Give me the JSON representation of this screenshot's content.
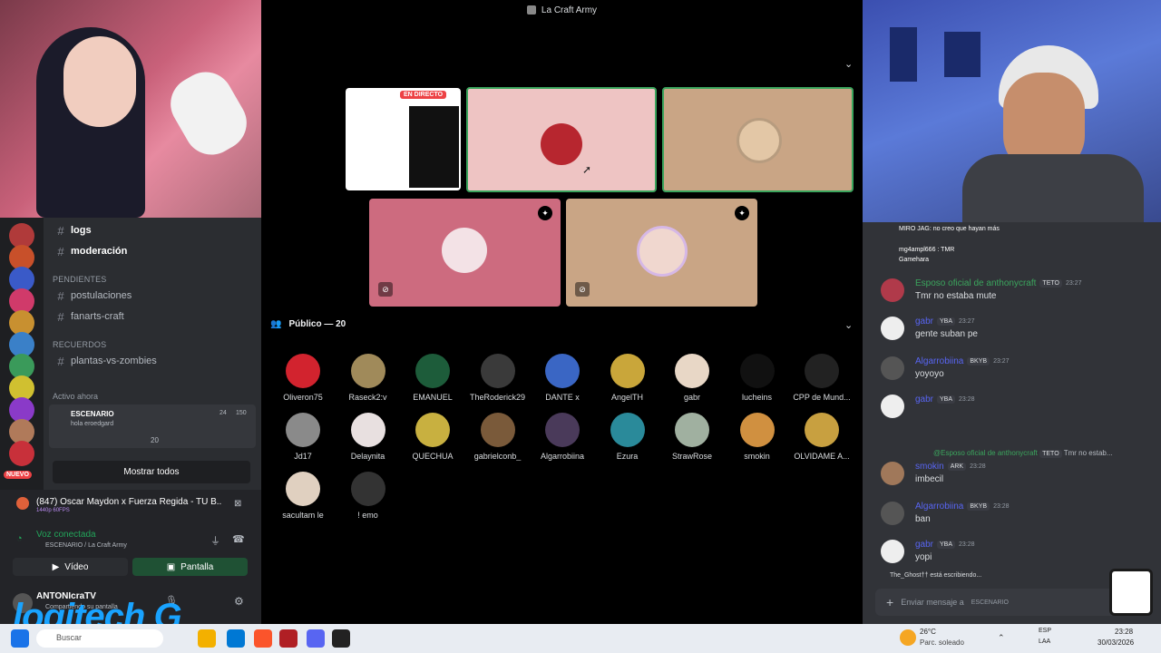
{
  "stage": {
    "title": "La Craft Army",
    "live_badge": "EN DIRECTO",
    "audience_header": "Público — 20",
    "audience": [
      {
        "name": "Oliveron75",
        "color": "#d2232e"
      },
      {
        "name": "Raseck2:v",
        "color": "#a08a5a"
      },
      {
        "name": "EMANUEL",
        "color": "#1d5c3a"
      },
      {
        "name": "TheRoderick29",
        "color": "#3a3a3a"
      },
      {
        "name": "DANTE x",
        "color": "#3a66c4"
      },
      {
        "name": "AngelTH",
        "color": "#c9a63a"
      },
      {
        "name": "gabr",
        "color": "#e8d7c6"
      },
      {
        "name": "lucheins",
        "color": "#111111"
      },
      {
        "name": "CPP de Mund...",
        "color": "#222222"
      },
      {
        "name": "Jd17",
        "color": "#8a8a8a"
      },
      {
        "name": "Delaynita",
        "color": "#e8e0e0"
      },
      {
        "name": "QUECHUA",
        "color": "#c8b040"
      },
      {
        "name": "gabrielconb_",
        "color": "#7a5a3a"
      },
      {
        "name": "Algarrobiina",
        "color": "#4a3a5a"
      },
      {
        "name": "Ezura",
        "color": "#2a8a9a"
      },
      {
        "name": "StrawRose",
        "color": "#a0b0a0"
      },
      {
        "name": "smokin",
        "color": "#d09040"
      },
      {
        "name": "OLVIDAME A...",
        "color": "#c8a040"
      },
      {
        "name": "sacultam le",
        "color": "#e0d0c0"
      },
      {
        "name": "! emo",
        "color": "#333333"
      }
    ]
  },
  "sidebar": {
    "channels_top": [
      "logs",
      "moderación"
    ],
    "pending_category": "Pendientes",
    "pending_channels": [
      "postulaciones",
      "fanarts-craft"
    ],
    "memories_category": "RECUERDOS",
    "memories_channels": [
      "plantas-vs-zombies"
    ],
    "active_now": "Activo ahora",
    "stage_label": "ESCENARIO",
    "stage_topic": "hola eroedgard",
    "stage_cam_count": "24",
    "stage_count": "150",
    "stage_listeners": "20",
    "show_all": "Mostrar todos",
    "new_badge": "NUEVO",
    "server_badges": [
      "76",
      "7",
      "80",
      "31",
      "1",
      "2",
      "2"
    ],
    "media_title": "(847) Oscar Maydon x Fuerza Regida - TU B...",
    "media_sub": "1440p 60FPS",
    "voice_connected": "Voz conectada",
    "voice_channel": "ESCENARIO / La Craft Army",
    "video_button": "Vídeo",
    "screen_button": "Pantalla",
    "user_name": "ANTONIcraTV",
    "user_status": "Compartiendo su pantalla"
  },
  "chat": {
    "messages": [
      {
        "author": "Esposo oficial de anthonycraft",
        "tag": "TETO",
        "time": "23:27",
        "text": "Tmr no estaba mute",
        "color": "#3ba55d"
      },
      {
        "author": "gabr",
        "tag": "YBA",
        "time": "23:27",
        "text": "gente suban pe",
        "color": "#5865f2"
      },
      {
        "author": "Algarrobiina",
        "tag": "BKYB",
        "time": "23:27",
        "text": "yoyoyo",
        "color": "#5865f2"
      },
      {
        "author": "gabr",
        "tag": "YBA",
        "time": "23:28",
        "text": "",
        "color": "#5865f2"
      },
      {
        "author": "smokin",
        "tag": "ARK",
        "time": "23:28",
        "text": "imbecil",
        "color": "#5865f2"
      },
      {
        "author": "Algarrobiina",
        "tag": "BKYB",
        "time": "23:28",
        "text": "ban",
        "color": "#5865f2"
      },
      {
        "author": "gabr",
        "tag": "YBA",
        "time": "23:28",
        "text": "yopi",
        "color": "#5865f2"
      }
    ],
    "reply_ref": "@Esposo oficial de anthonycraft",
    "reply_tag": "TETO",
    "reply_text": "Tmr no estab...",
    "overlay_lines": [
      "MIRO JAG: no creo que hayan más",
      "mg4ampl666 : TMR",
      "Gamehara"
    ],
    "typing": "The_Ghost†† está escribiendo...",
    "input_placeholder": "Enviar mensaje a",
    "input_channel": "ESCENARIO"
  },
  "taskbar": {
    "search": "Buscar",
    "weather_temp": "26°C",
    "weather_desc": "Parc. soleado",
    "lang": "ESP",
    "lang2": "LAA",
    "time": "23:28",
    "date": "30/03/2026"
  },
  "overlay": {
    "logo_text": "logitech G"
  },
  "colors": {
    "accent": "#5865f2",
    "green": "#23a55a",
    "stage_pink": "#f0c4c8",
    "tile_brown": "#c9a585"
  }
}
